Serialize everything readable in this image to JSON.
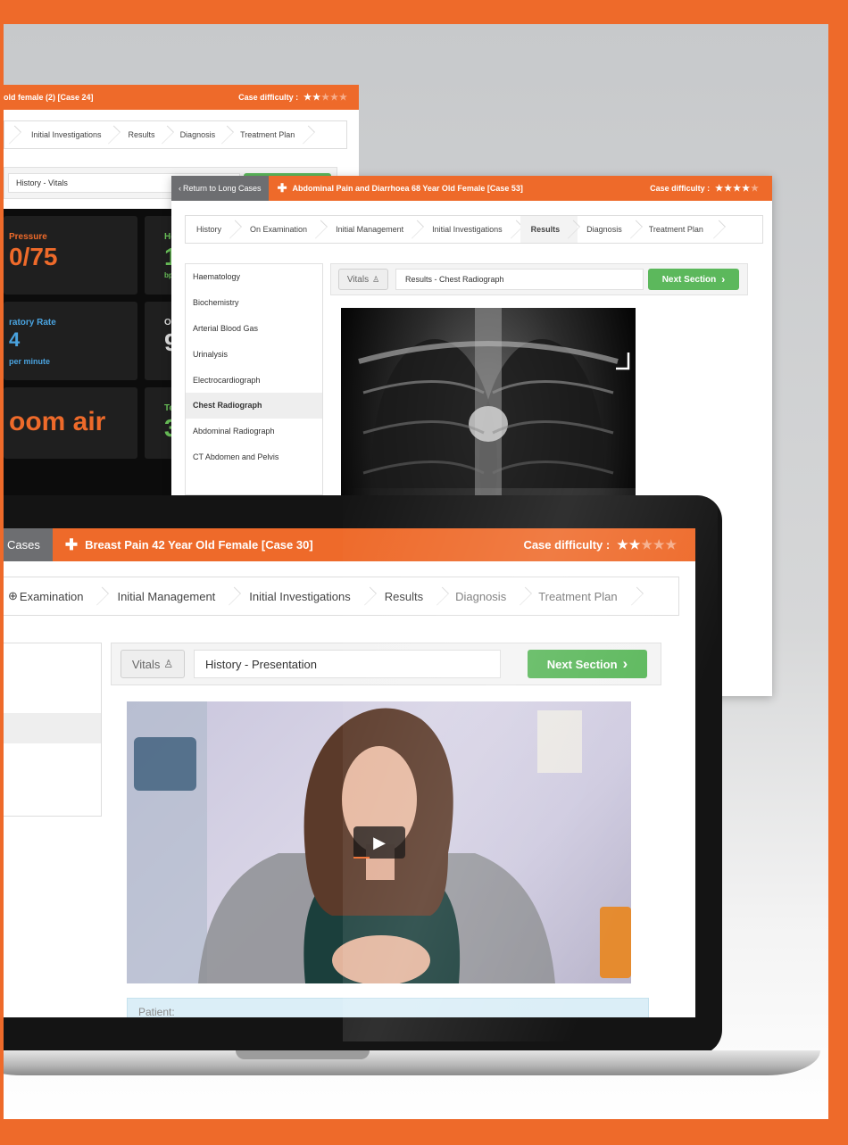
{
  "colors": {
    "brand_orange": "#ee6a2a",
    "next_green": "#5cb85c",
    "back_gray": "#6d6e71"
  },
  "panel_back": {
    "title": "old female (2) [Case 24]",
    "difficulty_label": "Case difficulty :",
    "difficulty": {
      "filled": 2,
      "total": 5
    },
    "steps": [
      "Initial Investigations",
      "Results",
      "Diagnosis",
      "Treatment Plan"
    ],
    "section_field": "History - Vitals",
    "vitals": {
      "bp_label": "Pressure",
      "bp_value": "0/75",
      "resp_label": "ratory Rate",
      "resp_value": "4",
      "resp_unit": "per minute",
      "o2_value": "oom air",
      "hr_label": "He",
      "hr_value": "1",
      "hr_unit": "bpm",
      "o2sat_label": "O2",
      "o2sat_value": "9",
      "temp_label": "Te",
      "temp_value": "3"
    }
  },
  "panel_mid": {
    "back_label": "Return to Long Cases",
    "title": "Abdominal Pain and Diarrhoea 68 Year Old Female [Case 53]",
    "difficulty_label": "Case difficulty :",
    "difficulty": {
      "filled": 4,
      "total": 5
    },
    "steps": [
      "History",
      "On Examination",
      "Initial Management",
      "Initial Investigations",
      "Results",
      "Diagnosis",
      "Treatment Plan"
    ],
    "active_step": "Results",
    "results_list": [
      "Haematology",
      "Biochemistry",
      "Arterial Blood Gas",
      "Urinalysis",
      "Electrocardiograph",
      "Chest Radiograph",
      "Abdominal Radiograph",
      "CT Abdomen and Pelvis"
    ],
    "active_result": "Chest Radiograph",
    "vitals_button": "Vitals",
    "section_field": "Results - Chest Radiograph",
    "next_button": "Next Section"
  },
  "laptop": {
    "back_label": "Cases",
    "title": "Breast Pain 42 Year Old Female [Case 30]",
    "difficulty_label": "Case difficulty :",
    "difficulty": {
      "filled": 2,
      "total": 5
    },
    "steps": [
      "Examination",
      "Initial Management",
      "Initial Investigations",
      "Results",
      "Diagnosis",
      "Treatment Plan"
    ],
    "vitals_button": "Vitals",
    "section_field": "History - Presentation",
    "next_button": "Next Section",
    "patient_label": "Patient:"
  }
}
